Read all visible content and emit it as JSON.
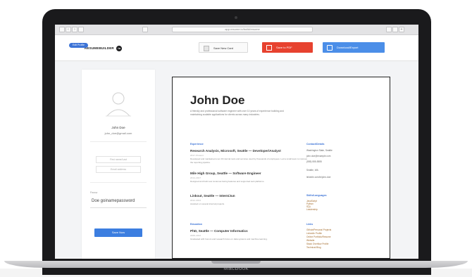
{
  "device": {
    "brand": "MacBook"
  },
  "browser": {
    "url": "app.resume.io/build/resume"
  },
  "header": {
    "logo_text": "RESUMEBUILDER",
    "logo_mark": "io",
    "save_label": "Save New Card",
    "pdf_label": "Save to PDF",
    "download_label": "Download/Export"
  },
  "sidebar": {
    "badge": "Edit Profile",
    "user_name": "John Doe",
    "user_email": "john_doe@gmail.com",
    "first_field_placeholder": "First name/Last",
    "second_field_placeholder": "Email address",
    "password_label": "Passw",
    "password_value": "Doe goinamepassword",
    "save_label": "Save Now"
  },
  "resume": {
    "name": "John Doe",
    "summary": "A friendly and professional software engineer with over 10 years of experience building and maintaining scalable applications for clients across many industries.",
    "experience_title": "Experience",
    "jobs": [
      {
        "title": "Research Analysis, Microsoft, Seattle — Developer/Analyst",
        "sub": "2017–Present",
        "desc": "Developed and maintained over 20 internal tools and services used by thousands of employees. Led a small team to improve the reporting pipeline."
      },
      {
        "title": "Mile High Group, Seattle — Software Engineer",
        "sub": "2014–2017",
        "desc": "Designed and built new customer-facing features and supported web platforms."
      },
      {
        "title": "Linkout, Seattle — Intern/Jun",
        "sub": "2012–2014",
        "desc": "Assisted on several internal projects."
      }
    ],
    "education_title": "Education",
    "education": {
      "title": "PhD, Seattle — Computer Informatics",
      "sub": "2008–2012",
      "desc": "Graduated with honors and research focus on data systems and machine learning."
    },
    "contact_title": "Contact/Details",
    "contact_items": [
      "Washington State, Seattle",
      "john.doe@example.com",
      "(555) 555-5555",
      "Seattle, WA",
      "linkedin.com/in/john-doe"
    ],
    "skills_title": "Skills/Languages",
    "skills": [
      "JavaScript",
      "Python",
      "SQL",
      "Leadership"
    ],
    "links_title": "Links",
    "links": [
      "Github/Personal Projects",
      "LinkedIn Profile",
      "Online Portfolio/Resume",
      "Website",
      "Stack Overflow Profile",
      "Technical Blog"
    ]
  }
}
